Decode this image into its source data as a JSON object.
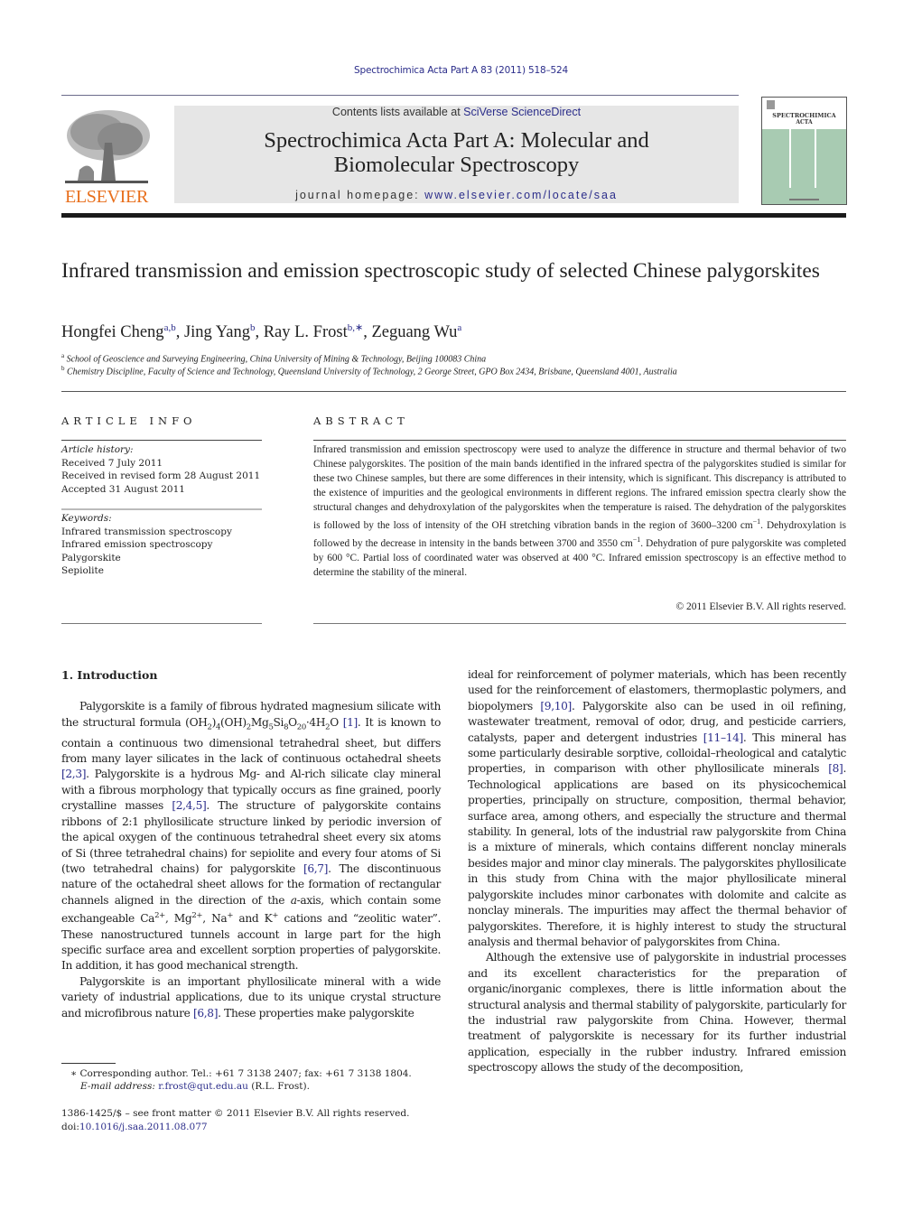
{
  "running_head": "Spectrochimica Acta Part A 83 (2011) 518–524",
  "publisher": {
    "logo_icon": "elsevier-tree-icon",
    "wordmark": "ELSEVIER",
    "brand_color": "#e86f1c"
  },
  "masthead": {
    "contents_prefix": "Contents lists available at ",
    "contents_link": "SciVerse ScienceDirect",
    "journal_title_line1": "Spectrochimica Acta Part A: Molecular and",
    "journal_title_line2": "Biomolecular Spectroscopy",
    "homepage_prefix": "journal homepage: ",
    "homepage_link": "www.elsevier.com/locate/saa",
    "link_color": "#2b2d8a",
    "background": "#e6e6e6"
  },
  "cover": {
    "title_line1": "SPECTROCHIMICA",
    "title_line2": "ACTA",
    "color": "#a8cbb2"
  },
  "article": {
    "title": "Infrared transmission and emission spectroscopic study of selected Chinese palygorskites",
    "authors": [
      {
        "name": "Hongfei Cheng",
        "sup": "a,b",
        "sep": ", "
      },
      {
        "name": "Jing Yang",
        "sup": "b",
        "sep": ", "
      },
      {
        "name": "Ray L. Frost",
        "sup": "b,∗",
        "sep": ", "
      },
      {
        "name": "Zeguang Wu",
        "sup": "a",
        "sep": ""
      }
    ],
    "affiliations": [
      {
        "key": "a",
        "text": "School of Geoscience and Surveying Engineering, China University of Mining & Technology, Beijing 100083 China"
      },
      {
        "key": "b",
        "text": "Chemistry Discipline, Faculty of Science and Technology, Queensland University of Technology, 2 George Street, GPO Box 2434, Brisbane, Queensland 4001, Australia"
      }
    ]
  },
  "article_info": {
    "heading": "ARTICLE INFO",
    "history_label": "Article history:",
    "history": [
      "Received 7 July 2011",
      "Received in revised form 28 August 2011",
      "Accepted 31 August 2011"
    ],
    "keywords_label": "Keywords:",
    "keywords": [
      "Infrared transmission spectroscopy",
      "Infrared emission spectroscopy",
      "Palygorskite",
      "Sepiolite"
    ]
  },
  "abstract": {
    "heading": "ABSTRACT",
    "part1": "Infrared transmission and emission spectroscopy were used to analyze the difference in structure and thermal behavior of two Chinese palygorskites. The position of the main bands identified in the infrared spectra of the palygorskites studied is similar for these two Chinese samples, but there are some differences in their intensity, which is significant. This discrepancy is attributed to the existence of impurities and the geological environments in different regions. The infrared emission spectra clearly show the structural changes and dehydroxylation of the palygorskites when the temperature is raised. The dehydration of the palygorskites is followed by the loss of intensity of the OH stretching vibration bands in the region of 3600–3200 cm",
    "sup1": "−1",
    "part2": ". Dehydroxylation is followed by the decrease in intensity in the bands between 3700 and 3550 cm",
    "sup2": "−1",
    "part3": ". Dehydration of pure palygorskite was completed by 600 °C. Partial loss of coordinated water was observed at 400 °C. Infrared emission spectroscopy is an effective method to determine the stability of the mineral.",
    "copyright": "© 2011 Elsevier B.V. All rights reserved."
  },
  "intro": {
    "heading": "1.  Introduction",
    "p1": {
      "t1": "Palygorskite is a family of fibrous hydrated magnesium silicate with the structural formula (OH",
      "s1": "2",
      "t2": ")",
      "s2": "4",
      "t3": "(OH)",
      "s3": "2",
      "t4": "Mg",
      "s4": "5",
      "t5": "Si",
      "s5": "8",
      "t6": "O",
      "s6": "20",
      "t7": "·4H",
      "s7": "2",
      "t8": "O ",
      "c1": "[1]",
      "t9": ". It is known to contain a continuous two dimensional tetrahedral sheet, but differs from many layer silicates in the lack of continuous octahedral sheets ",
      "c2": "[2,3]",
      "t10": ". Palygorskite is a hydrous Mg- and Al-rich silicate clay mineral with a fibrous morphology that typically occurs as fine grained, poorly crystalline masses ",
      "c3": "[2,4,5]",
      "t11": ". The structure of palygorskite contains ribbons of 2:1 phyllosilicate structure linked by periodic inversion of the apical oxygen of the continuous tetrahedral sheet every six atoms of Si (three tetrahedral chains) for sepiolite and every four atoms of Si (two tetrahedral chains) for palygorskite ",
      "c4": "[6,7]",
      "t12": ". The discontinuous nature of the octahedral sheet allows for the formation of rectangular channels aligned in the direction of the ",
      "it1": "a",
      "t13": "-axis, which contain some exchangeable Ca",
      "u1": "2+",
      "t14": ", Mg",
      "u2": "2+",
      "t15": ", Na",
      "u3": "+",
      "t16": " and K",
      "u4": "+",
      "t17": " cations and “zeolitic water”. These nanostructured tunnels account in large part for the high specific surface area and excellent sorption properties of palygorskite. In addition, it has good mechanical strength."
    },
    "p2": {
      "t1": "Palygorskite is an important phyllosilicate mineral with a wide variety of industrial applications, due to its unique crystal structure and microfibrous nature ",
      "c1": "[6,8]",
      "t2": ". These properties make palygorskite ideal for reinforcement of polymer materials, which has been recently used for the reinforcement of elastomers, thermoplastic polymers, and biopolymers ",
      "c2": "[9,10]",
      "t3": ". Palygorskite also can be used in oil refining, wastewater treatment, removal of odor, drug, and pesticide carriers, catalysts, paper and detergent industries ",
      "c3": "[11–14]",
      "t4": ". This mineral has some particularly desirable sorptive, colloidal–rheological and catalytic properties, in comparison with other phyllosilicate minerals ",
      "c4": "[8]",
      "t5": ". Technological applications are based on its physicochemical properties, principally on structure, composition, thermal behavior, surface area, among others, and especially the structure and thermal stability. In general, lots of the industrial raw palygorskite from China is a mixture of minerals, which contains different nonclay minerals besides major and minor clay minerals. The palygorskites phyllosilicate in this study from China with the major phyllosilicate mineral palygorskite includes minor carbonates with dolomite and calcite as nonclay minerals. The impurities may affect the thermal behavior of palygorskites. Therefore, it is highly interest to study the structural analysis and thermal behavior of palygorskites from China."
    },
    "p3": "Although the extensive use of palygorskite in industrial processes and its excellent characteristics for the preparation of organic/inorganic complexes, there is little information about the structural analysis and thermal stability of palygorskite, particularly for the industrial raw palygorskite from China. However, thermal treatment of palygorskite is necessary for its further industrial application, especially in the rubber industry. Infrared emission spectroscopy allows the study of the decomposition,"
  },
  "footnotes": {
    "star": "∗",
    "corresponding": "Corresponding author. Tel.: +61 7 3138 2407; fax: +61 7 3138 1804.",
    "email_label": "E-mail address: ",
    "email": "r.frost@qut.edu.au",
    "email_suffix": " (R.L. Frost).",
    "front_matter": "1386-1425/$ – see front matter © 2011 Elsevier B.V. All rights reserved.",
    "doi_prefix": "doi:",
    "doi": "10.1016/j.saa.2011.08.077"
  }
}
